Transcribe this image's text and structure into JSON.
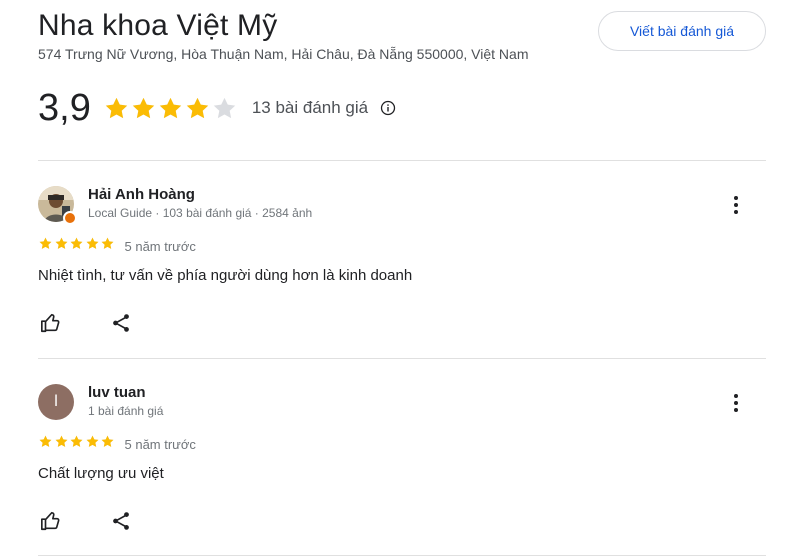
{
  "place": {
    "title": "Nha khoa Việt Mỹ",
    "address": "574 Trưng Nữ Vương, Hòa Thuận Nam, Hải Châu, Đà Nẵng 550000, Việt Nam",
    "write_review_label": "Viết bài đánh giá"
  },
  "rating": {
    "value_text": "3,9",
    "value": 3.9,
    "max": 5,
    "count_label": "13 bài đánh giá",
    "star_color": "#fbbc04",
    "empty_star_color": "#dadce0"
  },
  "reviews": [
    {
      "name": "Hải Anh Hoàng",
      "meta": "Local Guide · 103 bài đánh giá · 2584 ảnh",
      "avatar": "photo",
      "local_guide": true,
      "stars": 5,
      "time": "5 năm trước",
      "text": "Nhiệt tình, tư vấn về phía người dùng hơn là kinh doanh"
    },
    {
      "name": "luv tuan",
      "meta": "1 bài đánh giá",
      "avatar": "letter",
      "avatar_letter": "l",
      "avatar_color": "#8d6e63",
      "local_guide": false,
      "stars": 5,
      "time": "5 năm trước",
      "text": "Chất lượng ưu việt"
    }
  ],
  "icons": {
    "star": "star-icon",
    "info": "info-icon",
    "more": "more-vert-icon",
    "like": "thumb-up-icon",
    "share": "share-icon",
    "guide_badge": "local-guide-badge-icon"
  }
}
